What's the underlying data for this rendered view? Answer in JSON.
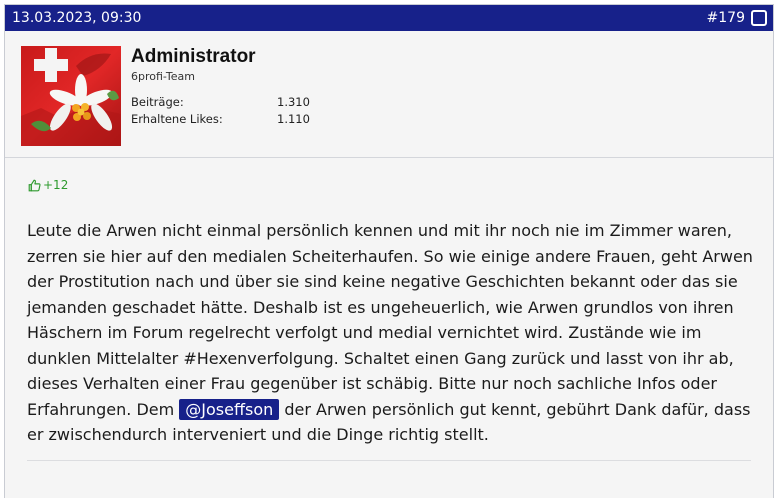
{
  "post": {
    "date": "13.03.2023, 09:30",
    "number": "#179"
  },
  "user": {
    "name": "Administrator",
    "title": "6profi-Team",
    "stats": [
      {
        "label": "Beiträge:",
        "value": "1.310"
      },
      {
        "label": "Erhaltene Likes:",
        "value": "1.110"
      }
    ]
  },
  "likes": "+12",
  "text": {
    "before": "Leute die Arwen nicht einmal persönlich kennen und mit ihr noch nie im Zimmer waren, zerren sie hier auf den medialen Scheiterhaufen. So wie einige andere Frauen, geht Arwen der Prostitution nach und über sie sind keine negative Geschichten bekannt oder das sie jemanden geschadet hätte. Deshalb ist es ungeheuerlich, wie Arwen grundlos von ihren Häschern im Forum regelrecht verfolgt und medial vernichtet wird. Zustände wie im dunklen Mittelalter #Hexenverfolgung. Schaltet einen Gang zurück und lasst von ihr ab, dieses Verhalten einer Frau gegenüber ist schäbig. Bitte nur noch sachliche Infos oder Erfahrungen. Dem ",
    "mention": "@Joseffson",
    "after": " der Arwen persönlich gut kennt, gebührt Dank dafür, dass er zwischendurch interveniert und die Dinge richtig stellt."
  },
  "icons": {
    "like": "thumbs-up-icon",
    "select": "checkbox-icon"
  }
}
